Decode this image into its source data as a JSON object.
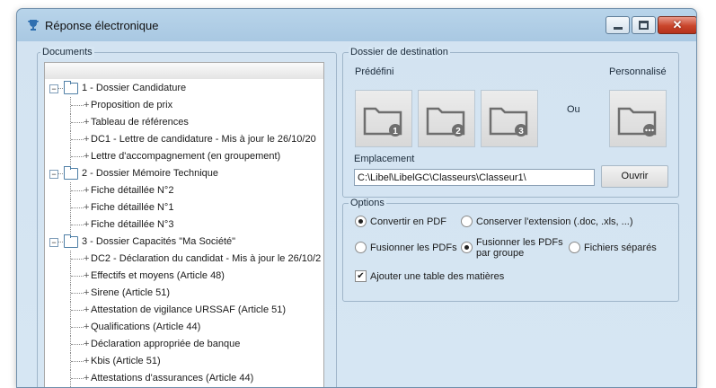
{
  "window": {
    "title": "Réponse électronique",
    "close_glyph": "✕"
  },
  "documents": {
    "legend": "Documents",
    "nodes": [
      {
        "type": "folder",
        "label": "1 - Dossier Candidature",
        "toggle": "−"
      },
      {
        "type": "item",
        "label": "Proposition de prix"
      },
      {
        "type": "item",
        "label": "Tableau de références"
      },
      {
        "type": "item",
        "label": "DC1 - Lettre de candidature - Mis à jour le 26/10/20"
      },
      {
        "type": "item",
        "label": "Lettre d'accompagnement (en groupement)"
      },
      {
        "type": "folder",
        "label": "2 - Dossier Mémoire Technique",
        "toggle": "−"
      },
      {
        "type": "item",
        "label": "Fiche détaillée N°2"
      },
      {
        "type": "item",
        "label": "Fiche détaillée N°1"
      },
      {
        "type": "item",
        "label": "Fiche détaillée N°3"
      },
      {
        "type": "folder",
        "label": "3 - Dossier Capacités \"Ma Société\"",
        "toggle": "−"
      },
      {
        "type": "item",
        "label": "DC2 - Déclaration du candidat - Mis à jour le 26/10/2"
      },
      {
        "type": "item",
        "label": "Effectifs et moyens (Article 48)"
      },
      {
        "type": "item",
        "label": "Sirene (Article 51)"
      },
      {
        "type": "item",
        "label": "Attestation de vigilance URSSAF (Article 51)"
      },
      {
        "type": "item",
        "label": "Qualifications (Article 44)"
      },
      {
        "type": "item",
        "label": "Déclaration appropriée de banque"
      },
      {
        "type": "item",
        "label": "Kbis (Article 51)"
      },
      {
        "type": "item",
        "label": "Attestations d'assurances (Article 44)"
      }
    ]
  },
  "destination": {
    "legend": "Dossier de destination",
    "predefini_label": "Prédéfini",
    "personnalise_label": "Personnalisé",
    "or_label": "Ou",
    "presets": [
      "1",
      "2",
      "3"
    ],
    "emplacement_label": "Emplacement",
    "emplacement_value": "C:\\Libel\\LibelGC\\Classeurs\\Classeur1\\",
    "open_button": "Ouvrir"
  },
  "options": {
    "legend": "Options",
    "convertir_pdf": "Convertir en PDF",
    "conserver_ext": "Conserver l'extension (.doc, .xls, ...)",
    "fusionner_pdfs": "Fusionner les PDFs",
    "fusionner_groupe_1": "Fusionner les PDFs",
    "fusionner_groupe_2": "par groupe",
    "fichiers_separes": "Fichiers séparés",
    "table_matieres": "Ajouter une table des matières",
    "check_glyph": "✔"
  }
}
